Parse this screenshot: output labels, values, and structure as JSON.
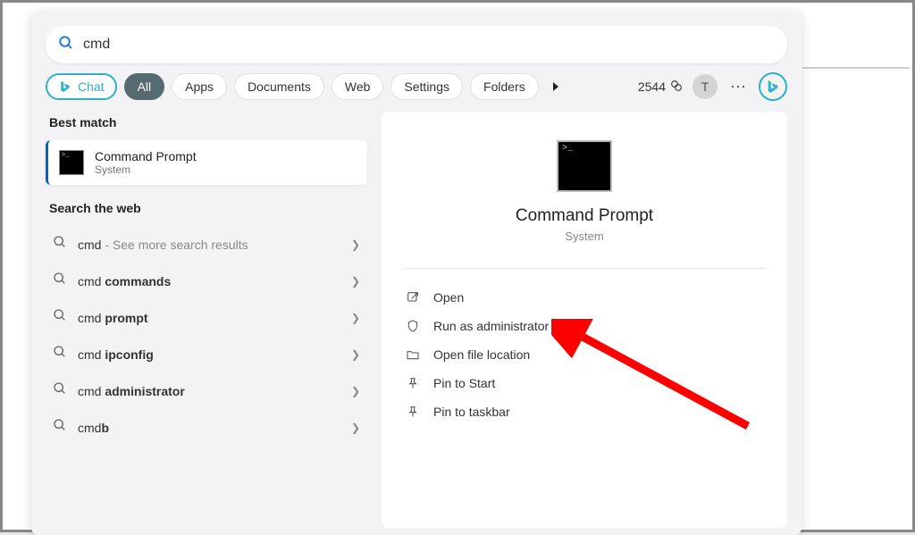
{
  "search": {
    "value": "cmd"
  },
  "filters": {
    "chat": "Chat",
    "all": "All",
    "apps": "Apps",
    "documents": "Documents",
    "web": "Web",
    "settings": "Settings",
    "folders": "Folders"
  },
  "header": {
    "points": "2544",
    "avatar_letter": "T"
  },
  "left": {
    "best_match_label": "Best match",
    "best": {
      "title": "Command Prompt",
      "subtitle": "System"
    },
    "web_label": "Search the web",
    "web_items": [
      {
        "prefix": "cmd",
        "bold": "",
        "suffix": " - See more search results"
      },
      {
        "prefix": "cmd ",
        "bold": "commands",
        "suffix": ""
      },
      {
        "prefix": "cmd ",
        "bold": "prompt",
        "suffix": ""
      },
      {
        "prefix": "cmd ",
        "bold": "ipconfig",
        "suffix": ""
      },
      {
        "prefix": "cmd ",
        "bold": "administrator",
        "suffix": ""
      },
      {
        "prefix": "cmd",
        "bold": "b",
        "suffix": ""
      }
    ]
  },
  "detail": {
    "title": "Command Prompt",
    "subtitle": "System",
    "actions": {
      "open": "Open",
      "run_admin": "Run as administrator",
      "file_loc": "Open file location",
      "pin_start": "Pin to Start",
      "pin_taskbar": "Pin to taskbar"
    }
  }
}
